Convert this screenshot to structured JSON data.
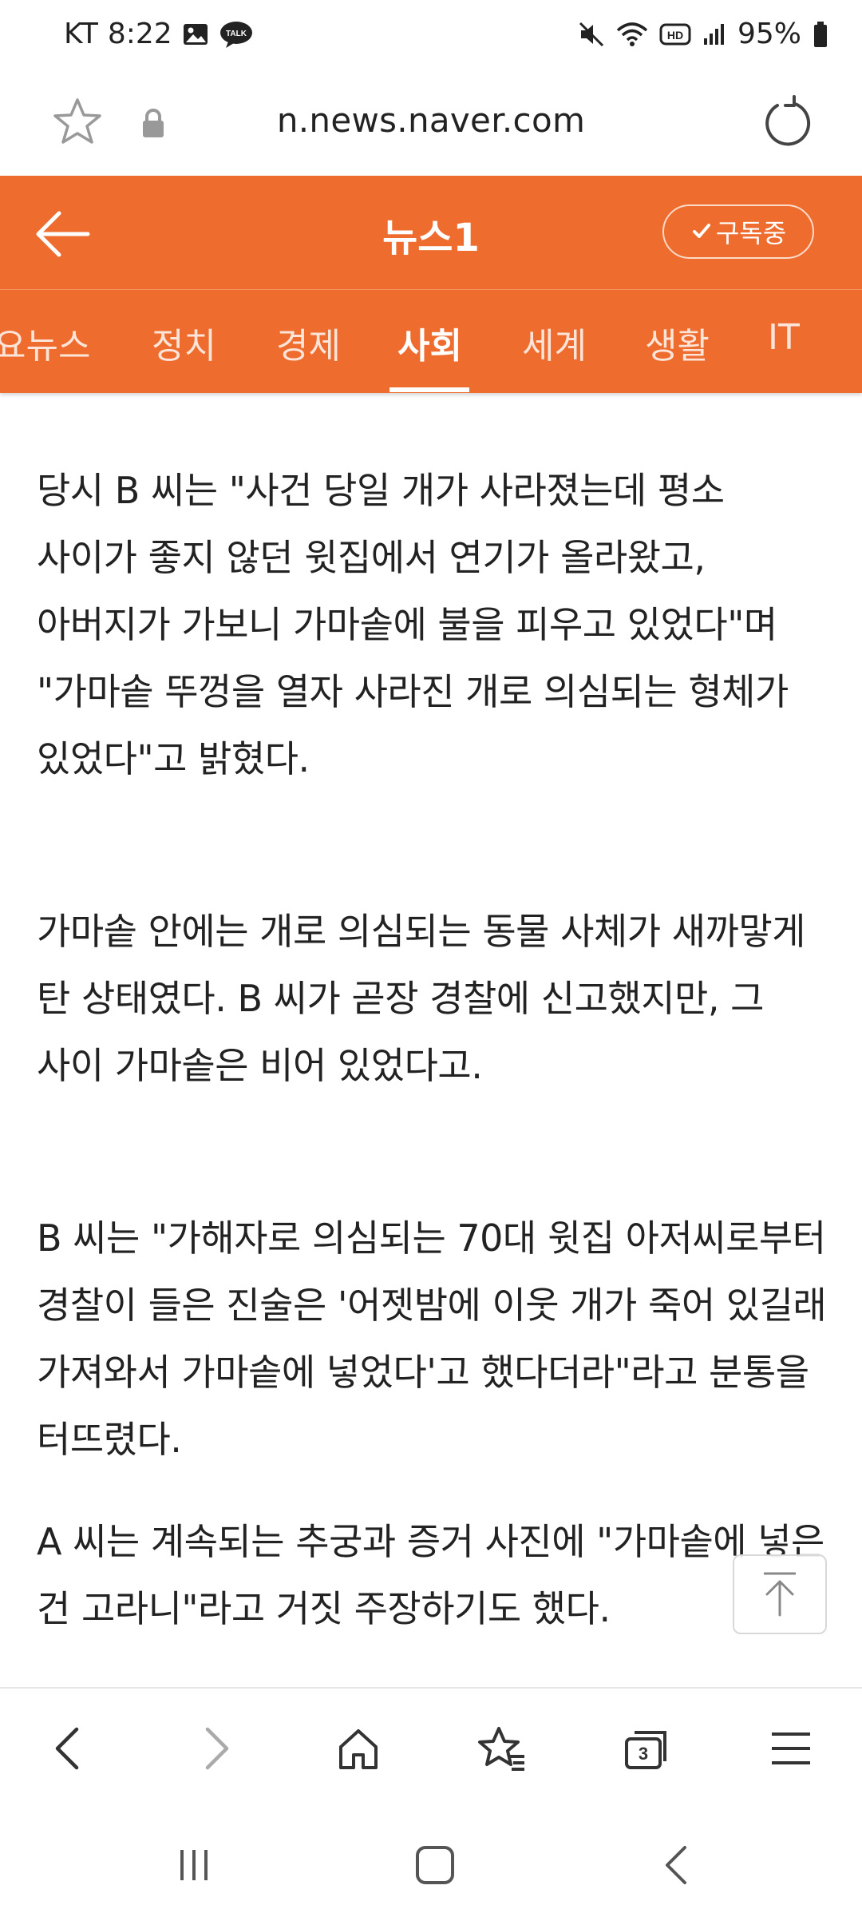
{
  "status_bar": {
    "carrier": "KT",
    "time": "8:22",
    "battery": "95%",
    "left_icons": [
      "gallery-icon",
      "talk-icon"
    ],
    "right_icons": [
      "mute-icon",
      "wifi-icon",
      "hd-icon",
      "signal-icon",
      "battery-icon"
    ],
    "talk_badge": "TALK",
    "hd_badge": "HD"
  },
  "url_bar": {
    "url": "n.news.naver.com"
  },
  "header": {
    "press": "뉴스1",
    "subscribe_label": "구독중"
  },
  "tabs": [
    {
      "label": "요뉴스",
      "active": false
    },
    {
      "label": "정치",
      "active": false
    },
    {
      "label": "경제",
      "active": false
    },
    {
      "label": "사회",
      "active": true
    },
    {
      "label": "세계",
      "active": false
    },
    {
      "label": "생활",
      "active": false
    },
    {
      "label": "IT",
      "active": false
    }
  ],
  "article": {
    "paragraphs": [
      "당시 B 씨는 \"사건 당일 개가 사라졌는데 평소 사이가 좋지 않던 윗집에서 연기가 올라왔고, 아버지가 가보니 가마솥에 불을 피우고 있었다\"며 \"가마솥 뚜껑을 열자 사라진 개로 의심되는 형체가 있었다\"고 밝혔다.",
      "가마솥 안에는 개로 의심되는 동물 사체가 새까맣게 탄 상태였다. B 씨가 곧장 경찰에 신고했지만, 그 사이 가마솥은 비어 있었다고.",
      "B 씨는 \"가해자로 의심되는 70대 윗집 아저씨로부터 경찰이 들은 진술은 '어젯밤에 이웃 개가 죽어 있길래 가져와서 가마솥에 넣었다'고 했다더라\"라고 분통을 터뜨렸다.",
      "A 씨는 계속되는 추궁과 증거 사진에 \"가마솥에 넣은 건 고라니\"라고 거짓 주장하기도 했다."
    ]
  },
  "toolbar": {
    "tab_count": "3",
    "icons": [
      "back-icon",
      "forward-icon",
      "home-icon",
      "bookmarks-icon",
      "tabs-icon",
      "menu-icon"
    ]
  },
  "colors": {
    "brand_orange": "#ee6c2e",
    "text": "#222222"
  }
}
